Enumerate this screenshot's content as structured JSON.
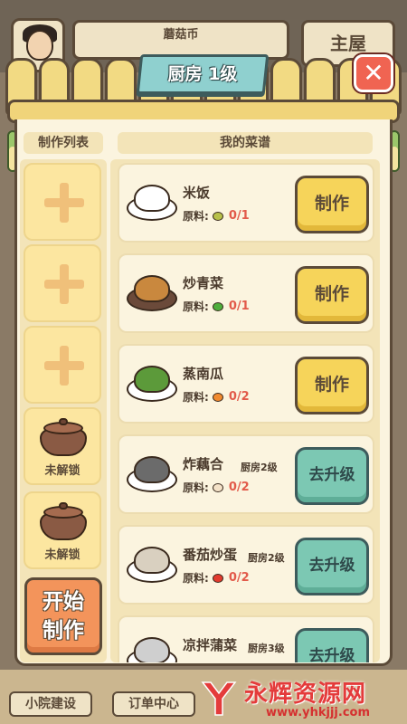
{
  "hud": {
    "currency_label": "蘑菇币",
    "home_label": "主屋"
  },
  "dialog": {
    "title": "厨房 1级",
    "close_symbol": "✕"
  },
  "left_column": {
    "header": "制作列表",
    "slots": [
      {
        "state": "empty",
        "label": ""
      },
      {
        "state": "empty",
        "label": ""
      },
      {
        "state": "empty",
        "label": ""
      },
      {
        "state": "locked",
        "label": "未解锁"
      },
      {
        "state": "locked",
        "label": "未解锁"
      }
    ],
    "start_button": [
      "开始",
      "制作"
    ]
  },
  "recipes": {
    "header": "我的菜谱",
    "ingredient_label": "原料:",
    "items": [
      {
        "name": "米饭",
        "level_req": "",
        "count": "0/1",
        "action": "制作",
        "action_type": "make",
        "food_color": "#ffffff",
        "ing_color": "#b7c04a",
        "ing_icon": "wheat-icon"
      },
      {
        "name": "炒青菜",
        "level_req": "",
        "count": "0/1",
        "action": "制作",
        "action_type": "make",
        "food_color": "#c9883e",
        "ing_color": "#4fae3c",
        "ing_icon": "cabbage-icon"
      },
      {
        "name": "蒸南瓜",
        "level_req": "",
        "count": "0/2",
        "action": "制作",
        "action_type": "make",
        "food_color": "#5c9a3a",
        "ing_color": "#f08a30",
        "ing_icon": "pumpkin-icon"
      },
      {
        "name": "炸藕合",
        "level_req": "厨房2级",
        "count": "0/2",
        "action": "去升级",
        "action_type": "upgrade",
        "food_color": "#6b6b6b",
        "ing_color": "#f4e2c8",
        "ing_icon": "lotus-root-icon"
      },
      {
        "name": "番茄炒蛋",
        "level_req": "厨房2级",
        "count": "0/2",
        "action": "去升级",
        "action_type": "upgrade",
        "food_color": "#d9d0c0",
        "ing_color": "#e23b2e",
        "ing_icon": "tomato-icon"
      },
      {
        "name": "凉拌蒲菜",
        "level_req": "厨房3级",
        "count": "",
        "action": "去升级",
        "action_type": "upgrade",
        "food_color": "#cfcfcf",
        "ing_color": "#9bc76b",
        "ing_icon": "reed-icon"
      }
    ]
  },
  "bottom_nav": {
    "left": "小院建设",
    "middle": "订单中心"
  },
  "watermark": {
    "title": "永辉资源网",
    "url": "www.yhkjjj.com"
  },
  "colors": {
    "accent_make": "#f6d45a",
    "accent_upgrade": "#7cc8b3",
    "accent_start": "#f3945b",
    "close_red": "#f06452"
  }
}
